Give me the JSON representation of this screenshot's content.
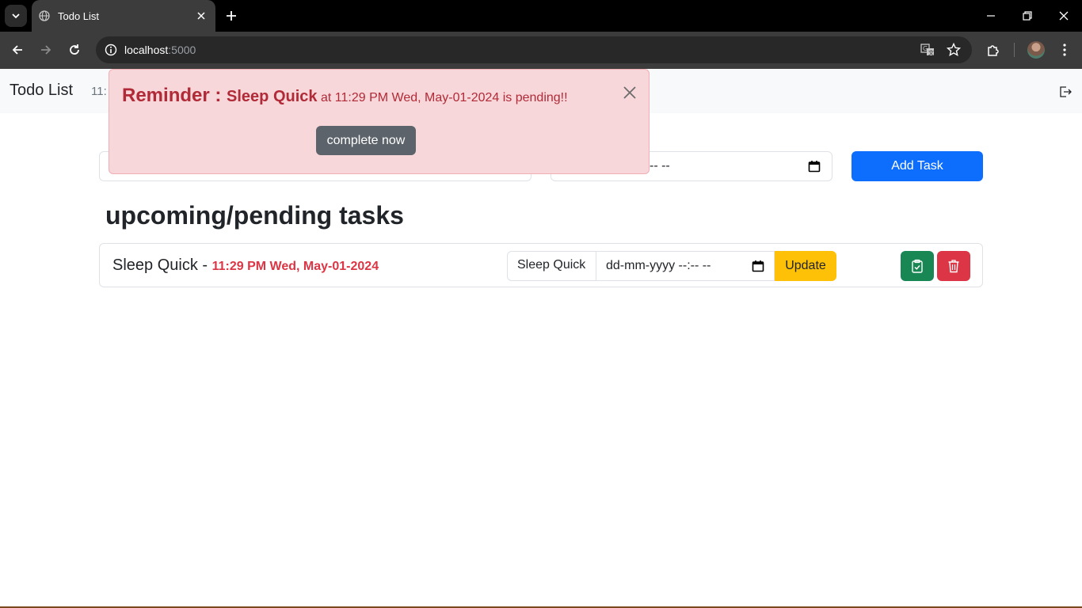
{
  "browser": {
    "tab_title": "Todo List",
    "url_host": "localhost",
    "url_port": ":5000"
  },
  "navbar": {
    "brand": "Todo List",
    "time_partial": "11:"
  },
  "form": {
    "date_partial": "-- --",
    "add_label": "Add Task"
  },
  "section": {
    "heading": "upcoming/pending tasks"
  },
  "tasks": [
    {
      "name": "Sleep Quick",
      "separator": " - ",
      "time": "11:29 PM Wed, May-01-2024",
      "edit_name": "Sleep Quick",
      "edit_date": "dd-mm-yyyy --:-- --",
      "update_label": "Update"
    }
  ],
  "alert": {
    "label": "Reminder : ",
    "task_name": "Sleep Quick",
    "message": " at 11:29 PM Wed, May-01-2024 is pending!!",
    "button": "complete now"
  },
  "colors": {
    "primary": "#0d6efd",
    "warning": "#ffc107",
    "success": "#198754",
    "danger": "#dc3545",
    "alert_bg": "#f8d7da",
    "alert_text": "#b02a37"
  },
  "icons": [
    "globe-icon",
    "close-icon",
    "plus-icon",
    "back-icon",
    "forward-icon",
    "reload-icon",
    "info-icon",
    "translate-icon",
    "star-icon",
    "extensions-icon",
    "menu-icon",
    "logout-icon",
    "calendar-icon",
    "clipboard-check-icon",
    "trash-icon"
  ]
}
